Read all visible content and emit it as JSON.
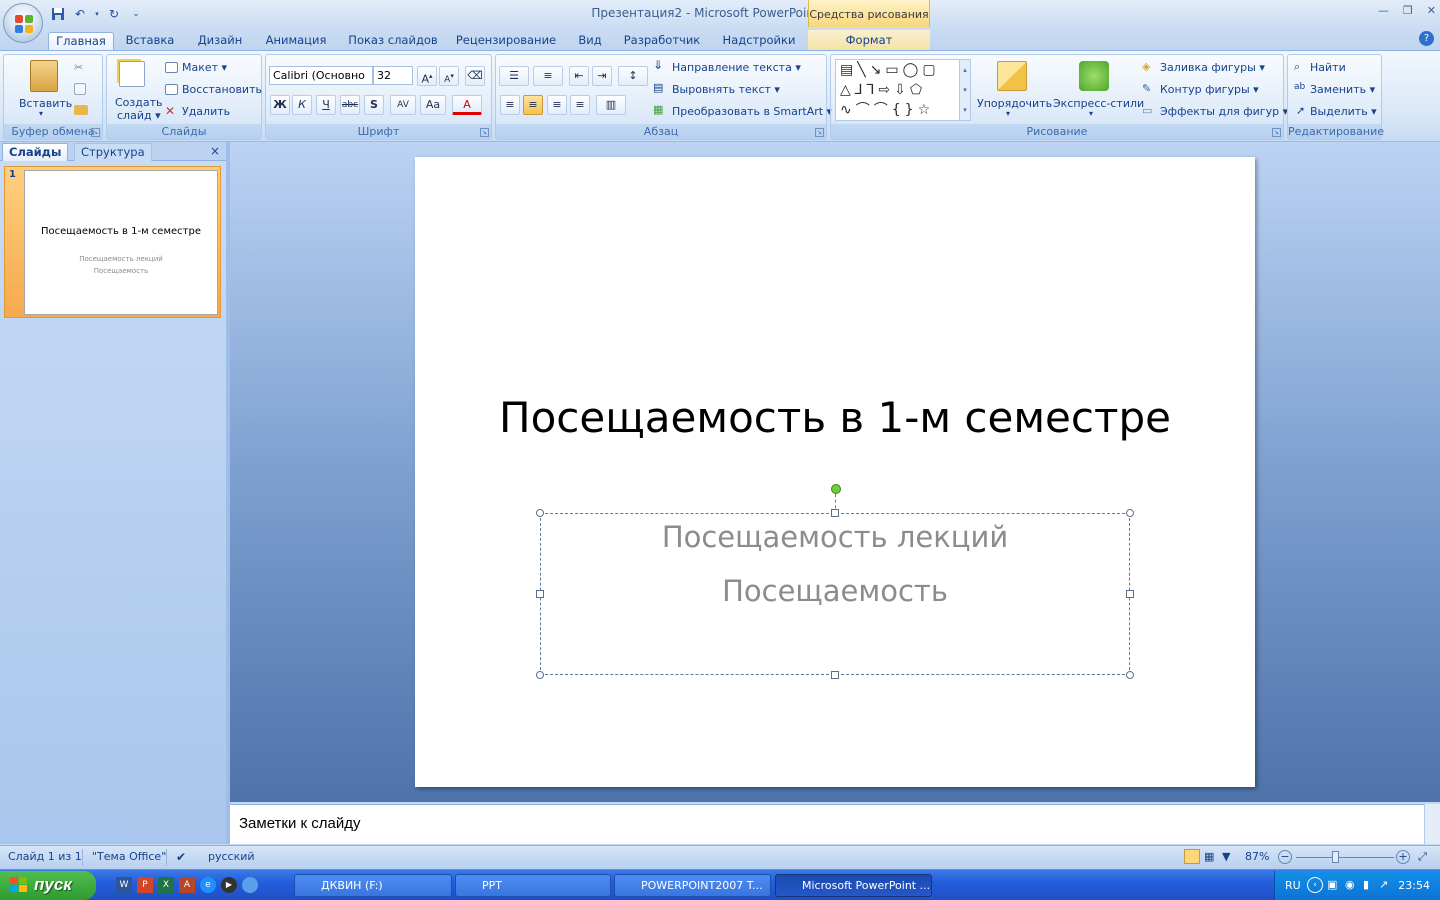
{
  "window": {
    "doc_title": "Презентация2",
    "app_title": "Microsoft PowerPoint",
    "separator": " - ",
    "context_group": "Средства рисования"
  },
  "tabs": [
    "Главная",
    "Вставка",
    "Дизайн",
    "Анимация",
    "Показ слайдов",
    "Рецензирование",
    "Вид",
    "Разработчик",
    "Надстройки"
  ],
  "context_tab": "Формат",
  "ribbon": {
    "clipboard": {
      "label": "Буфер обмена",
      "paste": "Вставить"
    },
    "slides": {
      "label": "Слайды",
      "new_slide_1": "Создать",
      "new_slide_2": "слайд ▾",
      "layout": "Макет ▾",
      "reset": "Восстановить",
      "delete": "Удалить"
    },
    "font": {
      "label": "Шрифт",
      "font_name": "Calibri (Основно",
      "font_size": "32",
      "bold": "Ж",
      "italic": "К",
      "underline": "Ч",
      "strike": "abc",
      "shadow": "S",
      "spacing": "AV",
      "case": "Aa",
      "color": "A"
    },
    "paragraph": {
      "label": "Абзац",
      "text_direction": "Направление текста ▾",
      "align_text": "Выровнять текст ▾",
      "smartart": "Преобразовать в SmartArt ▾"
    },
    "drawing": {
      "label": "Рисование",
      "arrange": "Упорядочить",
      "quick_styles": "Экспресс-стили",
      "fill": "Заливка фигуры ▾",
      "outline": "Контур фигуры ▾",
      "effects": "Эффекты для фигур ▾"
    },
    "editing": {
      "label": "Редактирование",
      "find": "Найти",
      "replace": "Заменить ▾",
      "select": "Выделить ▾"
    }
  },
  "pane": {
    "tab_slides": "Слайды",
    "tab_outline": "Структура",
    "close": "×",
    "slide_number": "1"
  },
  "slide": {
    "title": "Посещаемость в 1-м семестре",
    "subtitle_line1": "Посещаемость лекций",
    "subtitle_line2": "Посещаемость"
  },
  "notes_placeholder": "Заметки к слайду",
  "status": {
    "slide_info": "Слайд 1 из 1",
    "theme": "\"Тема Office\"",
    "language": "русский",
    "zoom": "87%"
  },
  "taskbar": {
    "start": "пуск",
    "tasks": [
      "ДКВИН (F:)",
      "PPT",
      "POWERPOINT2007 T...",
      "Microsoft PowerPoint ..."
    ],
    "lang": "RU",
    "clock": "23:54"
  },
  "colors": {
    "accent": "#15428b",
    "context": "#f7d77c",
    "taskbar": "#245edb"
  }
}
